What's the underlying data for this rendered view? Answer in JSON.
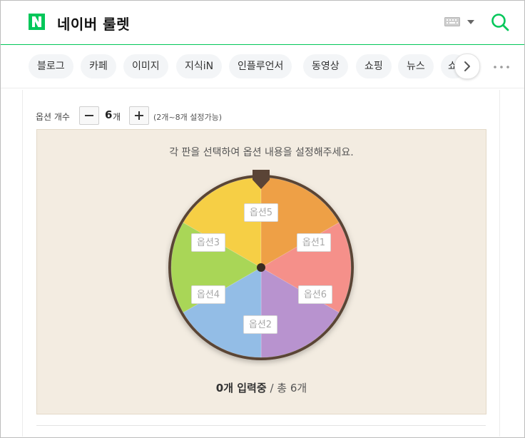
{
  "header": {
    "logo_letter": "N",
    "title": "네이버 룰렛",
    "icons": [
      "keyboard-icon",
      "caret-down-icon",
      "search-icon"
    ],
    "brand_color": "#03c75a"
  },
  "tabs": [
    {
      "label": "블로그"
    },
    {
      "label": "카페"
    },
    {
      "label": "이미지"
    },
    {
      "label": "지식iN"
    },
    {
      "label": "인플루언서"
    },
    {
      "label": "동영상"
    },
    {
      "label": "쇼핑"
    },
    {
      "label": "뉴스"
    },
    {
      "label": "쇼"
    }
  ],
  "options": {
    "label": "옵션 개수",
    "count": "6",
    "unit": "개",
    "range_hint": "(2개~8개 설정가능)"
  },
  "roulette": {
    "instruction": "각 판을 선택하여 옵션 내용을 설정해주세요.",
    "slices": [
      {
        "label": "옵션1",
        "color": "#f5908a"
      },
      {
        "label": "옵션6",
        "color": "#b893cf"
      },
      {
        "label": "옵션2",
        "color": "#93bde6"
      },
      {
        "label": "옵션4",
        "color": "#a9d657"
      },
      {
        "label": "옵션3",
        "color": "#f6cf45"
      },
      {
        "label": "옵션5",
        "color": "#eea046"
      }
    ],
    "status_count": "0개 입력중",
    "status_total": "/ 총 6개"
  }
}
